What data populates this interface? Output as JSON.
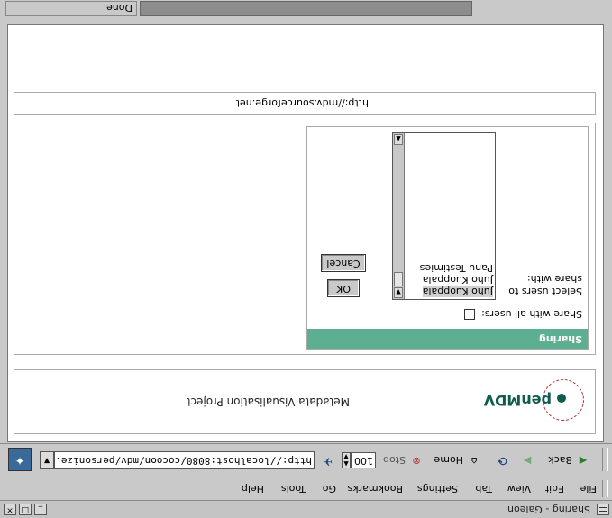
{
  "window": {
    "title": "Sharing - Galeon",
    "min": "_",
    "max": "□",
    "close": "×"
  },
  "menubar": {
    "items": [
      "File",
      "Edit",
      "View",
      "Tab",
      "Settings",
      "Bookmarks",
      "Go",
      "Tools",
      "Help"
    ]
  },
  "toolbar": {
    "back_label": "Back",
    "home_label": "Home",
    "stop_label": "Stop",
    "zoom": "100",
    "url": "http://localhost:8080/cocoon/mdv/personize.xml"
  },
  "page": {
    "logo_text": "penMDV",
    "project_title": "Metadata Visualisation Project",
    "sharing": {
      "header": "Sharing",
      "share_all_label": "Share with all users:",
      "select_label_line1": "Select users to",
      "select_label_line2": "share with:",
      "users": [
        "Juho   Kuoppala",
        "Juho   Kuoppala",
        "Panu   Testimies"
      ],
      "ok_label": "OK",
      "cancel_label": "Cancel"
    },
    "footer_url": "http://mdv.sourceforge.net"
  },
  "status": {
    "text": "Done."
  },
  "colors": {
    "sharing_header": "#5daf91",
    "logo": "#0f5b50"
  }
}
